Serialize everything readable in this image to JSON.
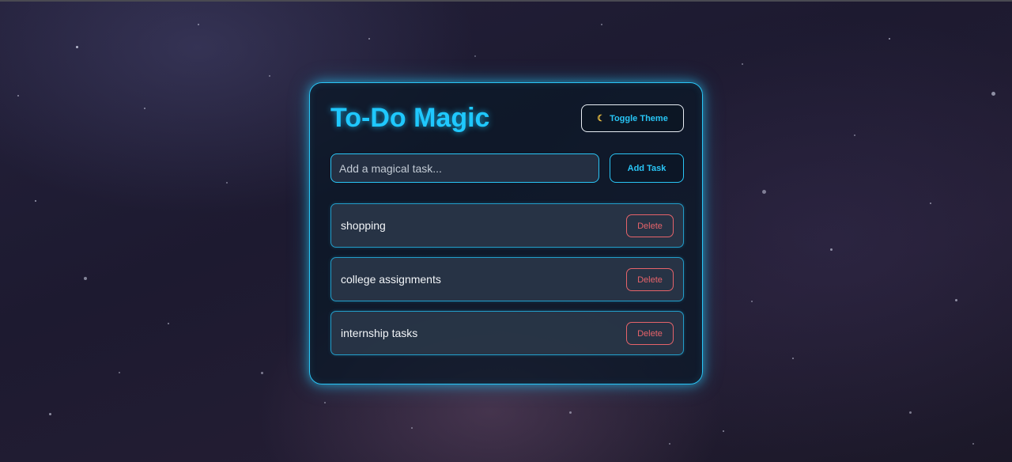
{
  "app": {
    "title": "To-Do Magic",
    "theme_toggle": {
      "icon": "moon-icon",
      "label": "Toggle Theme"
    }
  },
  "input": {
    "value": "",
    "placeholder": "Add a magical task..."
  },
  "add_button": {
    "label": "Add Task"
  },
  "tasks": [
    {
      "text": "shopping",
      "delete_label": "Delete"
    },
    {
      "text": "college assignments",
      "delete_label": "Delete"
    },
    {
      "text": "internship tasks",
      "delete_label": "Delete"
    }
  ],
  "colors": {
    "accent": "#29c5f6",
    "title": "#1fc8ff",
    "delete": "#e6636a",
    "card_bg": "#0c1828",
    "task_bg": "#2c384a"
  }
}
